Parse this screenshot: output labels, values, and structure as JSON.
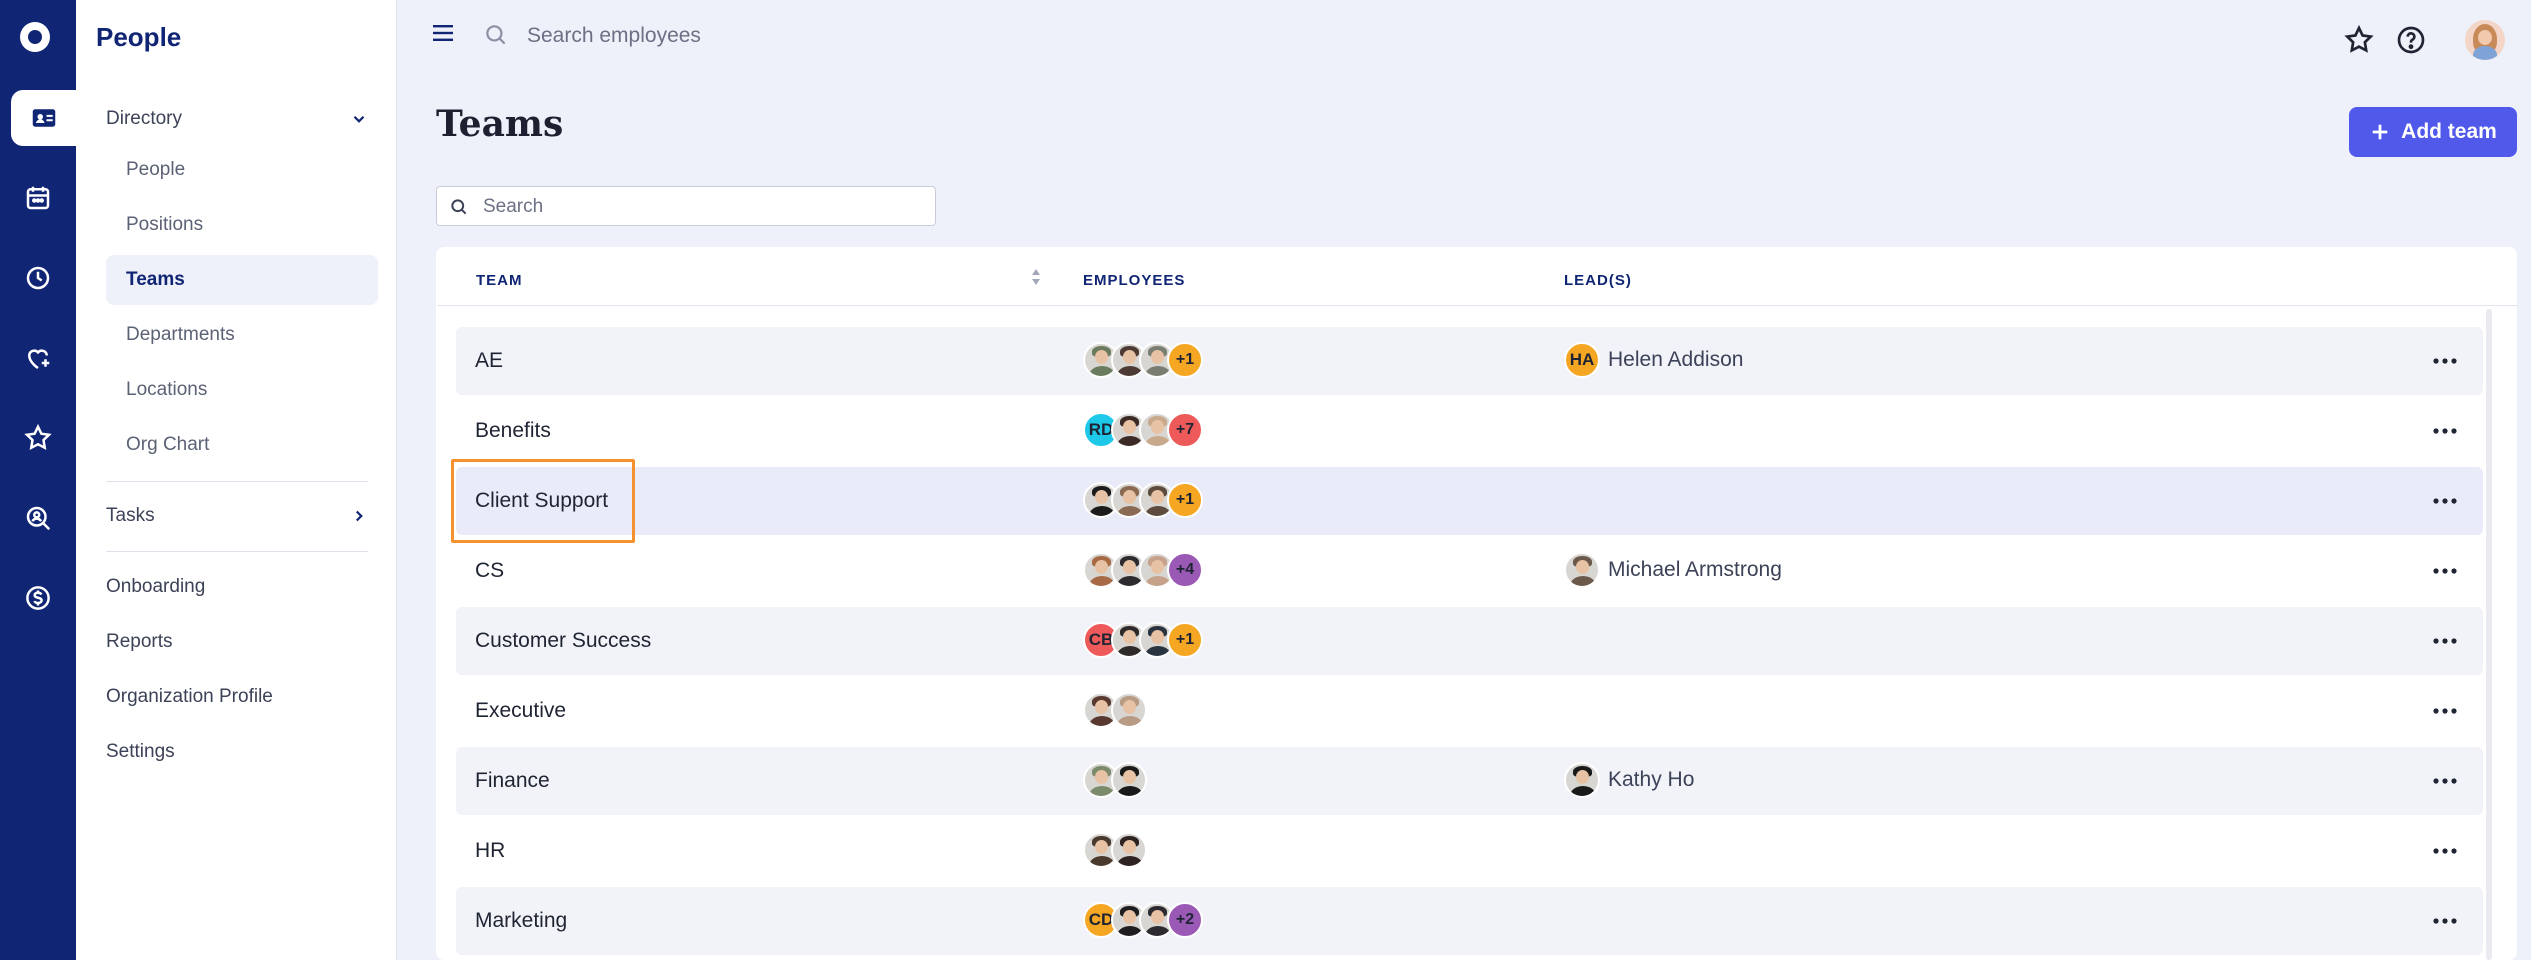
{
  "app": {
    "section_title": "People",
    "search_placeholder": "Search employees"
  },
  "rail": [
    "logo-icon",
    "id-card-icon",
    "calendar-icon",
    "clock-icon",
    "heart-plus-icon",
    "star-icon",
    "search-person-icon",
    "dollar-icon"
  ],
  "sidebar": {
    "directory_label": "Directory",
    "directory_items": [
      "People",
      "Positions",
      "Teams",
      "Departments",
      "Locations",
      "Org Chart"
    ],
    "active_item": "Teams",
    "tasks_label": "Tasks",
    "links": [
      "Onboarding",
      "Reports",
      "Organization Profile",
      "Settings"
    ]
  },
  "page": {
    "title": "Teams",
    "add_button": "Add team",
    "search_placeholder": "Search"
  },
  "colors": {
    "rail": "#102574",
    "accent": "#5059ea",
    "highlight_outline": "#f5922f"
  },
  "table": {
    "headers": {
      "team": "TEAM",
      "employees": "EMPLOYEES",
      "leads": "LEAD(S)"
    },
    "rows": [
      {
        "name": "AE",
        "employees": [
          {
            "kind": "photo",
            "tone": "#6b7b5d"
          },
          {
            "kind": "photo",
            "tone": "#4d3a34"
          },
          {
            "kind": "photo",
            "tone": "#7a7e72"
          }
        ],
        "more": "+1",
        "more_color": "#f5a623",
        "lead": "Helen Addison",
        "lead_initials": "HA",
        "lead_color": "#f5a623"
      },
      {
        "name": "Benefits",
        "employees": [
          {
            "kind": "initials",
            "text": "RD",
            "color": "#1ec8e8"
          },
          {
            "kind": "photo",
            "tone": "#3b2a25"
          },
          {
            "kind": "photo",
            "tone": "#c9a98c"
          }
        ],
        "more": "+7",
        "more_color": "#ee5a5a",
        "lead": ""
      },
      {
        "name": "Client Support",
        "employees": [
          {
            "kind": "photo",
            "tone": "#1c1c1c"
          },
          {
            "kind": "photo",
            "tone": "#8a6a52"
          },
          {
            "kind": "photo",
            "tone": "#5d4b3d"
          }
        ],
        "more": "+1",
        "more_color": "#f5a623",
        "lead": ""
      },
      {
        "name": "CS",
        "employees": [
          {
            "kind": "photo",
            "tone": "#a86a45"
          },
          {
            "kind": "photo",
            "tone": "#2d2b2f"
          },
          {
            "kind": "photo",
            "tone": "#c7a28a"
          }
        ],
        "more": "+4",
        "more_color": "#9b59b6",
        "lead": "Michael Armstrong",
        "lead_initials": "",
        "lead_color": "#6b5a4c"
      },
      {
        "name": "Customer Success",
        "employees": [
          {
            "kind": "initials",
            "text": "CB",
            "color": "#ee5a5a"
          },
          {
            "kind": "photo",
            "tone": "#2f2a2a"
          },
          {
            "kind": "photo",
            "tone": "#2a3340"
          }
        ],
        "more": "+1",
        "more_color": "#f5a623",
        "lead": ""
      },
      {
        "name": "Executive",
        "employees": [
          {
            "kind": "photo",
            "tone": "#5a3a30"
          },
          {
            "kind": "photo",
            "tone": "#b89b84"
          }
        ],
        "more": "",
        "lead": ""
      },
      {
        "name": "Finance",
        "employees": [
          {
            "kind": "photo",
            "tone": "#7a8a6a"
          },
          {
            "kind": "photo",
            "tone": "#1a1a1a"
          }
        ],
        "more": "",
        "lead": "Kathy Ho",
        "lead_initials": "",
        "lead_color": "#1a1a1a"
      },
      {
        "name": "HR",
        "employees": [
          {
            "kind": "photo",
            "tone": "#4a3a2e"
          },
          {
            "kind": "photo",
            "tone": "#2e2320"
          }
        ],
        "more": "",
        "lead": ""
      },
      {
        "name": "Marketing",
        "employees": [
          {
            "kind": "initials",
            "text": "CD",
            "color": "#f5a623"
          },
          {
            "kind": "photo",
            "tone": "#1f1d1f"
          },
          {
            "kind": "photo",
            "tone": "#2d2a30"
          }
        ],
        "more": "+2",
        "more_color": "#9b59b6",
        "lead": ""
      }
    ]
  }
}
